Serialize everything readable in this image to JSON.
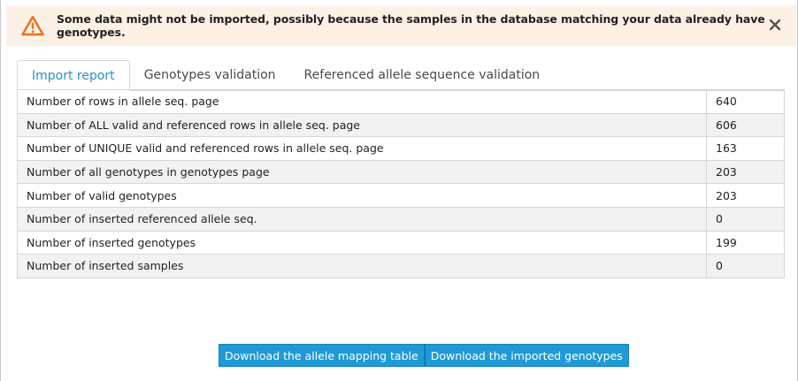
{
  "alert": {
    "icon": "warning-triangle-icon",
    "message": "Some data might not be imported, possibly because the samples in the database matching your data already have genotypes.",
    "close_icon": "close-icon",
    "color": "#e8721c"
  },
  "tabs": [
    {
      "label": "Import report",
      "active": true
    },
    {
      "label": "Genotypes validation",
      "active": false
    },
    {
      "label": "Referenced allele sequence validation",
      "active": false
    }
  ],
  "report": {
    "rows": [
      {
        "label": "Number of rows in allele seq. page",
        "value": "640"
      },
      {
        "label": "Number of ALL valid and referenced rows in allele seq. page",
        "value": "606"
      },
      {
        "label": "Number of UNIQUE valid and referenced rows in allele seq. page",
        "value": "163"
      },
      {
        "label": "Number of all genotypes in genotypes page",
        "value": "203"
      },
      {
        "label": "Number of valid genotypes",
        "value": "203"
      },
      {
        "label": "Number of inserted referenced allele seq.",
        "value": "0"
      },
      {
        "label": "Number of inserted genotypes",
        "value": "199"
      },
      {
        "label": "Number of inserted samples",
        "value": "0"
      }
    ]
  },
  "buttons": {
    "download_mapping": "Download the allele mapping table",
    "download_genotypes": "Download the imported genotypes"
  },
  "colors": {
    "accent": "#2b8fc7",
    "button": "#1e9ad6",
    "alert_bg": "#fdf1e6"
  }
}
